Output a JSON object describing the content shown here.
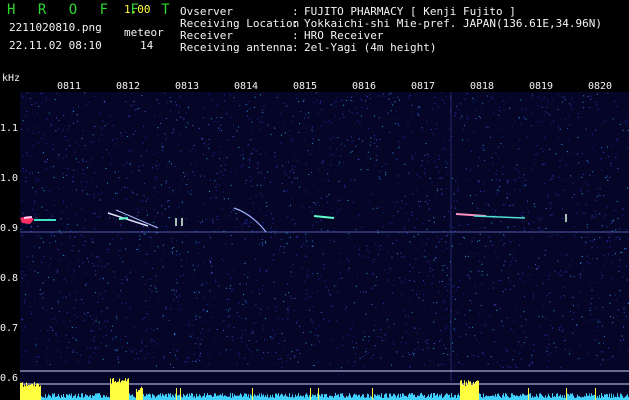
{
  "header": {
    "app_title": "H R O F F T",
    "app_version": "1.00",
    "file_name": "2211020810.png",
    "meteor_label": "meteor",
    "datetime": "22.11.02 08:10",
    "meteor_count": "14"
  },
  "info": [
    {
      "key": "Ovserver",
      "sep": ":",
      "value": "FUJITO PHARMACY [ Kenji Fujito ]"
    },
    {
      "key": "Receiving Location",
      "sep": ":",
      "value": "Yokkaichi-shi Mie-pref. JAPAN(136.61E,34.96N)"
    },
    {
      "key": "Receiver",
      "sep": ":",
      "value": "HRO Receiver"
    },
    {
      "key": "Receiving antenna",
      "sep": ":",
      "value": "2el-Yagi (4m height)"
    }
  ],
  "axis": {
    "y_unit": "kHz",
    "y_ticks": [
      {
        "label": "1.1",
        "value": 1.1
      },
      {
        "label": "1.0",
        "value": 1.0
      },
      {
        "label": "0.9",
        "value": 0.9
      },
      {
        "label": "0.8",
        "value": 0.8
      },
      {
        "label": "0.7",
        "value": 0.7
      },
      {
        "label": "0.6",
        "value": 0.6
      }
    ],
    "x_ticks": [
      "0811",
      "0812",
      "0813",
      "0814",
      "0815",
      "0816",
      "0817",
      "0818",
      "0819",
      "0820"
    ]
  },
  "colors": {
    "title_green": "#2fd62f",
    "text_white": "#f4f4f4",
    "meter_yellow": "#ffff40",
    "noise_cyan": "#3fd0ff",
    "background_navy": "#050528"
  }
}
